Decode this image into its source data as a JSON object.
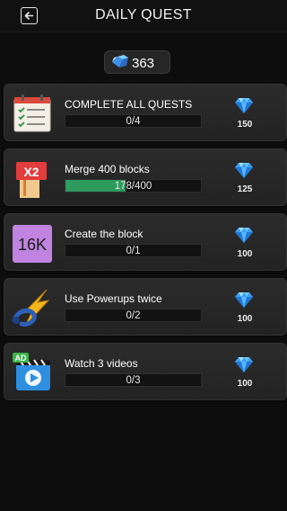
{
  "header": {
    "title": "DAILY QUEST"
  },
  "currency": {
    "amount": "363"
  },
  "quests": [
    {
      "title": "COMPLETE ALL QUESTS",
      "progress_text": "0/4",
      "progress": 0.0,
      "reward": "150",
      "icon": "checklist-icon"
    },
    {
      "title": "Merge 400 blocks",
      "progress_text": "178/400",
      "progress": 0.445,
      "reward": "125",
      "icon": "x2-multiplier-icon",
      "x2_label": "X2"
    },
    {
      "title": "Create the block",
      "progress_text": "0/1",
      "progress": 0.0,
      "reward": "100",
      "icon": "16k-block-icon",
      "block_label": "16K"
    },
    {
      "title": "Use Powerups twice",
      "progress_text": "0/2",
      "progress": 0.0,
      "reward": "100",
      "icon": "powerup-icon"
    },
    {
      "title": "Watch 3 videos",
      "progress_text": "0/3",
      "progress": 0.0,
      "reward": "100",
      "icon": "video-ad-icon",
      "ad_label": "AD"
    }
  ],
  "colors": {
    "progress_fill": "#2f9a5e",
    "gem": "#4fb3ff",
    "block_16k": "#c084e0"
  }
}
